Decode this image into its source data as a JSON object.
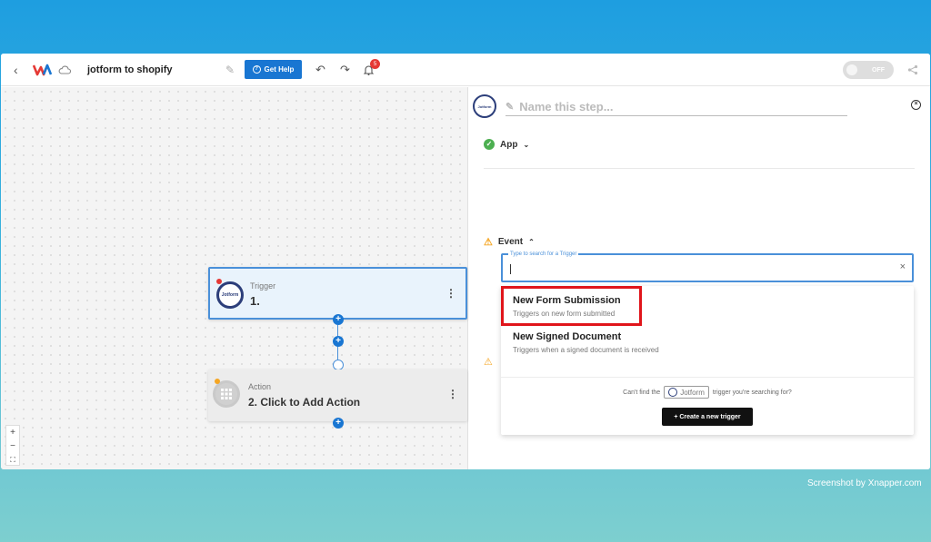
{
  "topbar": {
    "workflow_title": "jotform to shopify",
    "help_label": "Get Help",
    "notification_count": "5",
    "toggle_label": "OFF"
  },
  "canvas": {
    "trigger": {
      "type": "Trigger",
      "name": "1.",
      "logo_text": "Jotform"
    },
    "action": {
      "type": "Action",
      "name": "2. Click to Add Action"
    },
    "zoom": {
      "in": "+",
      "out": "−",
      "fit": "⛶"
    }
  },
  "panel": {
    "app_logo_text": "Jotform",
    "step_name_placeholder": "Name this step...",
    "app_label": "App",
    "event_label": "Event",
    "search_label": "Type to search for a Trigger",
    "options": [
      {
        "title": "New Form Submission",
        "desc": "Triggers on new form submitted"
      },
      {
        "title": "New Signed Document",
        "desc": "Triggers when a signed document is received"
      }
    ],
    "cant_find_prefix": "Can't find the",
    "cant_find_logo": "Jotform",
    "cant_find_suffix": "trigger you're searching for?",
    "create_label": "+ Create a new trigger"
  },
  "watermark": "Screenshot by Xnapper.com"
}
